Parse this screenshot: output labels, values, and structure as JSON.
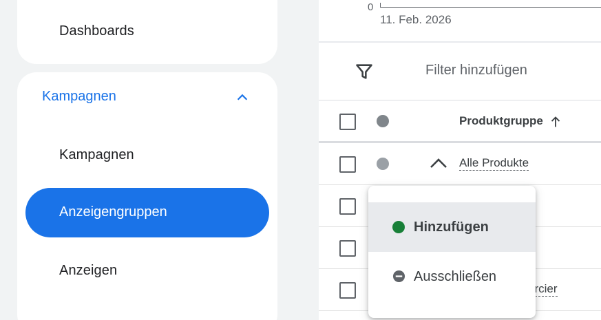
{
  "sidebar": {
    "dashboards_label": "Dashboards",
    "section": {
      "title": "Kampagnen",
      "expanded": true,
      "items": [
        {
          "label": "Kampagnen",
          "selected": false
        },
        {
          "label": "Anzeigengruppen",
          "selected": true
        },
        {
          "label": "Anzeigen",
          "selected": false
        }
      ]
    }
  },
  "chart": {
    "y_zero_label": "0",
    "x_date_label": "11. Feb. 2026"
  },
  "filter": {
    "label": "Filter hinzufügen",
    "icon": "filter-icon"
  },
  "table": {
    "header": {
      "column_label": "Produktgruppe",
      "sort": "ascending"
    },
    "rows": [
      {
        "label": "Alle Produkte",
        "expanded": true
      },
      {
        "label": ""
      },
      {
        "label": ""
      },
      {
        "label": "ercier"
      }
    ]
  },
  "menu": {
    "items": [
      {
        "label": "Hinzufügen",
        "icon": "green-dot-icon",
        "highlighted": true
      },
      {
        "label": "Ausschließen",
        "icon": "minus-circle-icon",
        "highlighted": false
      }
    ]
  },
  "colors": {
    "accent": "#1a73e8",
    "add_green": "#188038",
    "status_grey": "#80868b"
  }
}
